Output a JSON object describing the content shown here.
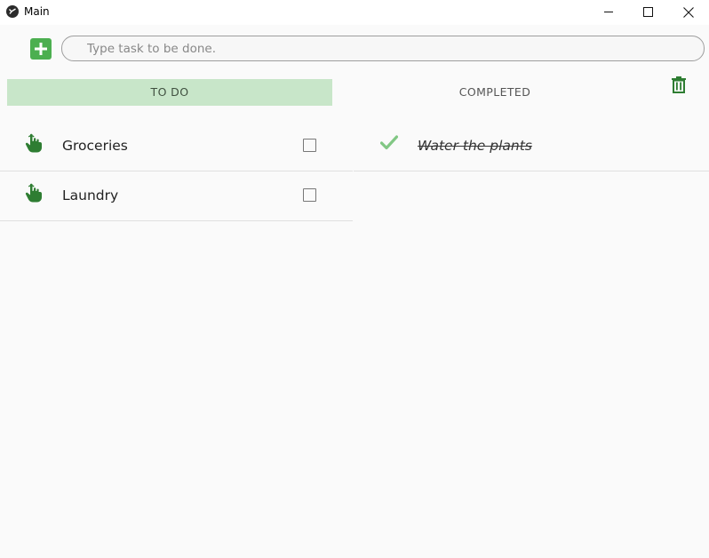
{
  "window": {
    "title": "Main",
    "minimize_icon": "minimize-icon",
    "maximize_icon": "maximize-icon",
    "close_icon": "close-icon"
  },
  "input": {
    "placeholder": "Type task to be done.",
    "value": "",
    "add_icon": "plus-icon"
  },
  "tabs": [
    {
      "label": "TO DO",
      "selected": true
    },
    {
      "label": "COMPLETED",
      "selected": false
    }
  ],
  "trash_icon": "trash-icon",
  "todo_items": [
    {
      "label": "Groceries",
      "checked": false,
      "icon": "drag-hand-icon"
    },
    {
      "label": "Laundry",
      "checked": false,
      "icon": "drag-hand-icon"
    }
  ],
  "completed_items": [
    {
      "label": "Water the plants",
      "icon": "checkmark-icon"
    }
  ],
  "colors": {
    "accent": "#4caf50",
    "tab_selected_bg": "#c8e6c9",
    "check_color": "#81c784",
    "dark_green": "#2e7d32"
  }
}
